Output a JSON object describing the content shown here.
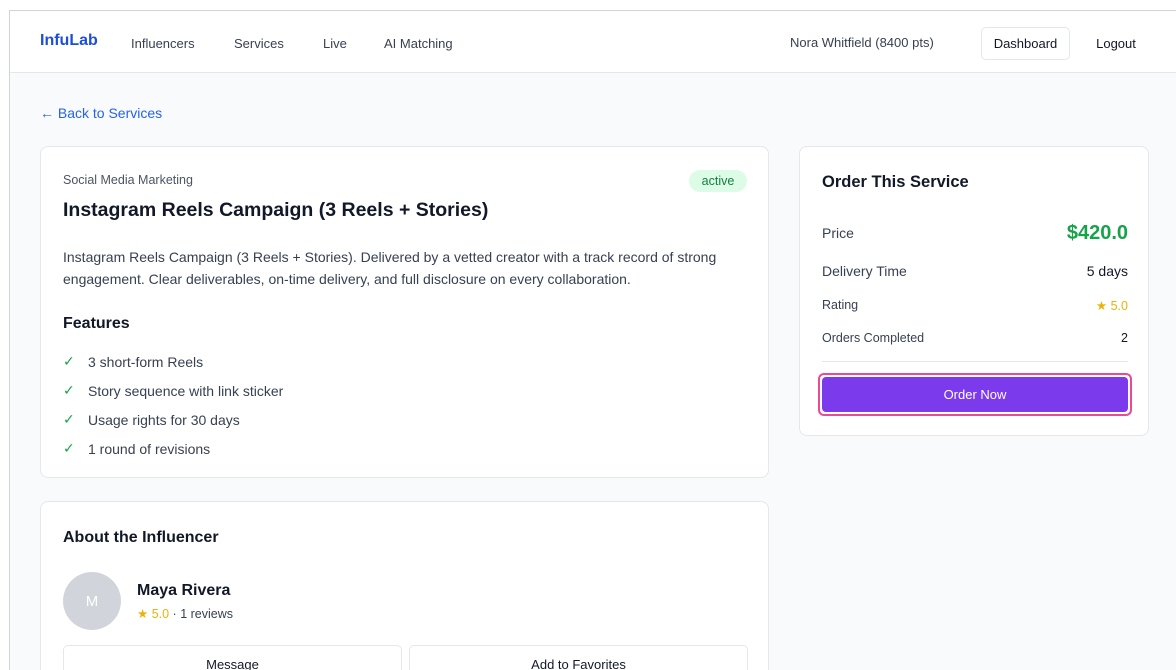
{
  "nav": {
    "brand": "InfuLab",
    "links": [
      "Influencers",
      "Services",
      "Live",
      "AI Matching"
    ],
    "user": "Nora Whitfield (8400 pts)",
    "dashboard_label": "Dashboard",
    "logout_label": "Logout"
  },
  "back_link": "← Back to Services",
  "service": {
    "category": "Social Media Marketing",
    "status": "active",
    "title": "Instagram Reels Campaign (3 Reels + Stories)",
    "description": "Instagram Reels Campaign (3 Reels + Stories). Delivered by a vetted creator with a track record of strong engagement. Clear deliverables, on-time delivery, and full disclosure on every collaboration.",
    "features_heading": "Features",
    "features": [
      "3 short-form Reels",
      "Story sequence with link sticker",
      "Usage rights for 30 days",
      "1 round of revisions"
    ]
  },
  "order": {
    "heading": "Order This Service",
    "price_label": "Price",
    "price": "$420.0",
    "delivery_label": "Delivery Time",
    "delivery": "5 days",
    "rating_label": "Rating",
    "rating": "5.0",
    "orders_label": "Orders Completed",
    "orders": "2",
    "button_label": "Order Now"
  },
  "influencer": {
    "heading": "About the Influencer",
    "avatar_initial": "M",
    "name": "Maya Rivera",
    "rating": "5.0",
    "reviews": "1 reviews",
    "message_label": "Message",
    "favorite_label": "Add to Favorites"
  },
  "colors": {
    "brand": "#1d4ed8",
    "accent": "#7c3aed",
    "price": "#16a34a",
    "highlight": "#ec4899"
  }
}
